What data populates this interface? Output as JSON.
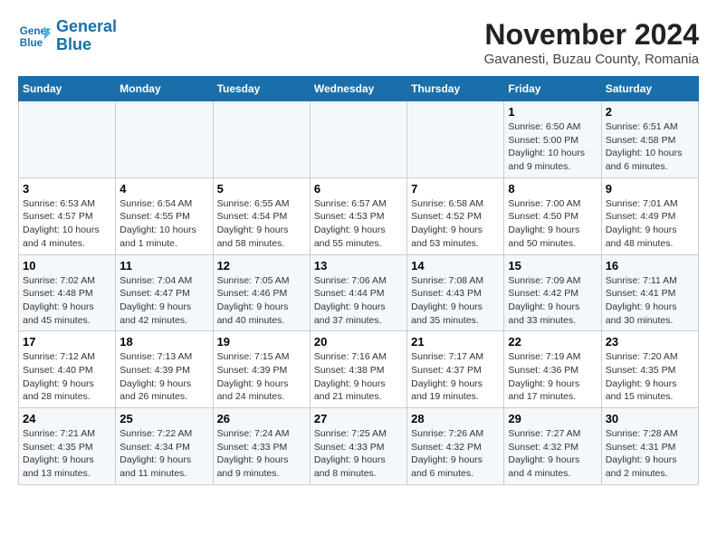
{
  "logo": {
    "line1": "General",
    "line2": "Blue"
  },
  "title": "November 2024",
  "subtitle": "Gavanesti, Buzau County, Romania",
  "weekdays": [
    "Sunday",
    "Monday",
    "Tuesday",
    "Wednesday",
    "Thursday",
    "Friday",
    "Saturday"
  ],
  "weeks": [
    [
      {
        "num": "",
        "info": ""
      },
      {
        "num": "",
        "info": ""
      },
      {
        "num": "",
        "info": ""
      },
      {
        "num": "",
        "info": ""
      },
      {
        "num": "",
        "info": ""
      },
      {
        "num": "1",
        "info": "Sunrise: 6:50 AM\nSunset: 5:00 PM\nDaylight: 10 hours and 9 minutes."
      },
      {
        "num": "2",
        "info": "Sunrise: 6:51 AM\nSunset: 4:58 PM\nDaylight: 10 hours and 6 minutes."
      }
    ],
    [
      {
        "num": "3",
        "info": "Sunrise: 6:53 AM\nSunset: 4:57 PM\nDaylight: 10 hours and 4 minutes."
      },
      {
        "num": "4",
        "info": "Sunrise: 6:54 AM\nSunset: 4:55 PM\nDaylight: 10 hours and 1 minute."
      },
      {
        "num": "5",
        "info": "Sunrise: 6:55 AM\nSunset: 4:54 PM\nDaylight: 9 hours and 58 minutes."
      },
      {
        "num": "6",
        "info": "Sunrise: 6:57 AM\nSunset: 4:53 PM\nDaylight: 9 hours and 55 minutes."
      },
      {
        "num": "7",
        "info": "Sunrise: 6:58 AM\nSunset: 4:52 PM\nDaylight: 9 hours and 53 minutes."
      },
      {
        "num": "8",
        "info": "Sunrise: 7:00 AM\nSunset: 4:50 PM\nDaylight: 9 hours and 50 minutes."
      },
      {
        "num": "9",
        "info": "Sunrise: 7:01 AM\nSunset: 4:49 PM\nDaylight: 9 hours and 48 minutes."
      }
    ],
    [
      {
        "num": "10",
        "info": "Sunrise: 7:02 AM\nSunset: 4:48 PM\nDaylight: 9 hours and 45 minutes."
      },
      {
        "num": "11",
        "info": "Sunrise: 7:04 AM\nSunset: 4:47 PM\nDaylight: 9 hours and 42 minutes."
      },
      {
        "num": "12",
        "info": "Sunrise: 7:05 AM\nSunset: 4:46 PM\nDaylight: 9 hours and 40 minutes."
      },
      {
        "num": "13",
        "info": "Sunrise: 7:06 AM\nSunset: 4:44 PM\nDaylight: 9 hours and 37 minutes."
      },
      {
        "num": "14",
        "info": "Sunrise: 7:08 AM\nSunset: 4:43 PM\nDaylight: 9 hours and 35 minutes."
      },
      {
        "num": "15",
        "info": "Sunrise: 7:09 AM\nSunset: 4:42 PM\nDaylight: 9 hours and 33 minutes."
      },
      {
        "num": "16",
        "info": "Sunrise: 7:11 AM\nSunset: 4:41 PM\nDaylight: 9 hours and 30 minutes."
      }
    ],
    [
      {
        "num": "17",
        "info": "Sunrise: 7:12 AM\nSunset: 4:40 PM\nDaylight: 9 hours and 28 minutes."
      },
      {
        "num": "18",
        "info": "Sunrise: 7:13 AM\nSunset: 4:39 PM\nDaylight: 9 hours and 26 minutes."
      },
      {
        "num": "19",
        "info": "Sunrise: 7:15 AM\nSunset: 4:39 PM\nDaylight: 9 hours and 24 minutes."
      },
      {
        "num": "20",
        "info": "Sunrise: 7:16 AM\nSunset: 4:38 PM\nDaylight: 9 hours and 21 minutes."
      },
      {
        "num": "21",
        "info": "Sunrise: 7:17 AM\nSunset: 4:37 PM\nDaylight: 9 hours and 19 minutes."
      },
      {
        "num": "22",
        "info": "Sunrise: 7:19 AM\nSunset: 4:36 PM\nDaylight: 9 hours and 17 minutes."
      },
      {
        "num": "23",
        "info": "Sunrise: 7:20 AM\nSunset: 4:35 PM\nDaylight: 9 hours and 15 minutes."
      }
    ],
    [
      {
        "num": "24",
        "info": "Sunrise: 7:21 AM\nSunset: 4:35 PM\nDaylight: 9 hours and 13 minutes."
      },
      {
        "num": "25",
        "info": "Sunrise: 7:22 AM\nSunset: 4:34 PM\nDaylight: 9 hours and 11 minutes."
      },
      {
        "num": "26",
        "info": "Sunrise: 7:24 AM\nSunset: 4:33 PM\nDaylight: 9 hours and 9 minutes."
      },
      {
        "num": "27",
        "info": "Sunrise: 7:25 AM\nSunset: 4:33 PM\nDaylight: 9 hours and 8 minutes."
      },
      {
        "num": "28",
        "info": "Sunrise: 7:26 AM\nSunset: 4:32 PM\nDaylight: 9 hours and 6 minutes."
      },
      {
        "num": "29",
        "info": "Sunrise: 7:27 AM\nSunset: 4:32 PM\nDaylight: 9 hours and 4 minutes."
      },
      {
        "num": "30",
        "info": "Sunrise: 7:28 AM\nSunset: 4:31 PM\nDaylight: 9 hours and 2 minutes."
      }
    ]
  ]
}
